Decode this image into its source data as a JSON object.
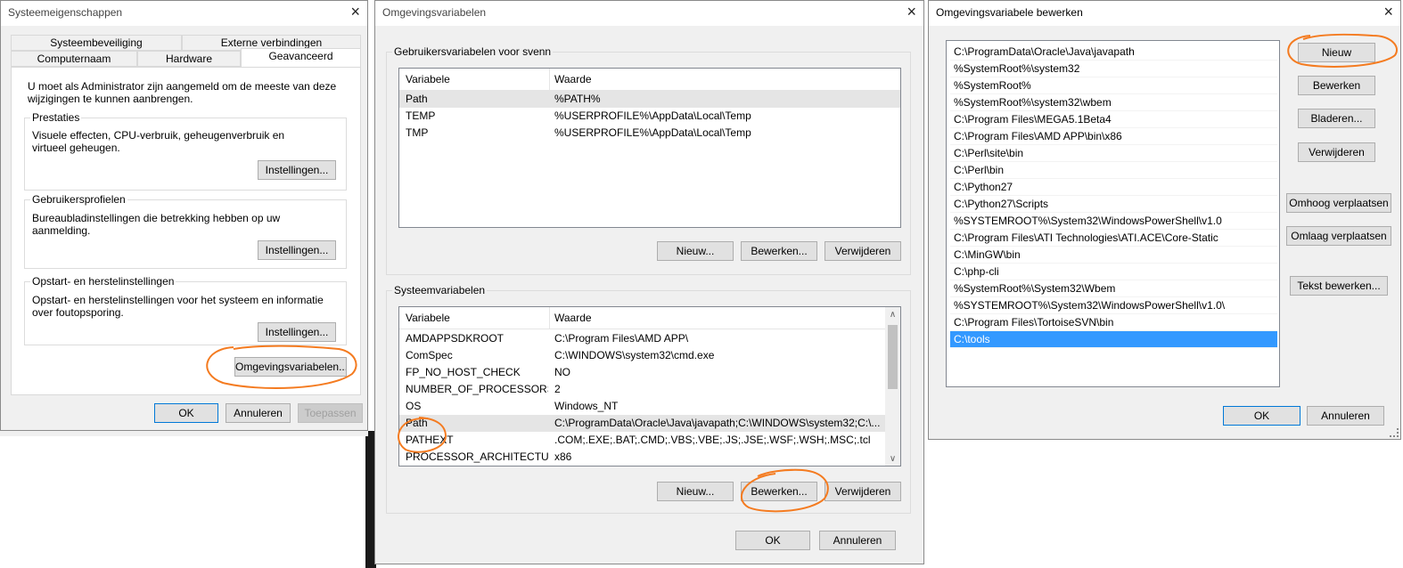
{
  "sysprops": {
    "title": "Systeemeigenschappen",
    "tabs_row1": [
      "Systeembeveiliging",
      "Externe verbindingen"
    ],
    "tabs_row2": [
      "Computernaam",
      "Hardware",
      "Geavanceerd"
    ],
    "admin_notice": "U moet als Administrator zijn aangemeld om de meeste van deze wijzigingen te kunnen aanbrengen.",
    "groups": [
      {
        "legend": "Prestaties",
        "text": "Visuele effecten, CPU-verbruik, geheugenverbruik en virtueel geheugen.",
        "button": "Instellingen..."
      },
      {
        "legend": "Gebruikersprofielen",
        "text": "Bureaubladinstellingen die betrekking hebben op uw aanmelding.",
        "button": "Instellingen..."
      },
      {
        "legend": "Opstart- en herstelinstellingen",
        "text": "Opstart- en herstelinstellingen voor het systeem en informatie over foutopsporing.",
        "button": "Instellingen..."
      }
    ],
    "envvars_button": "Omgevingsvariabelen...",
    "ok": "OK",
    "cancel": "Annuleren",
    "apply": "Toepassen"
  },
  "envvars": {
    "title": "Omgevingsvariabelen",
    "user_group": "Gebruikersvariabelen voor svenn",
    "col_var": "Variabele",
    "col_val": "Waarde",
    "user_rows": [
      {
        "name": "Path",
        "value": "%PATH%"
      },
      {
        "name": "TEMP",
        "value": "%USERPROFILE%\\AppData\\Local\\Temp"
      },
      {
        "name": "TMP",
        "value": "%USERPROFILE%\\AppData\\Local\\Temp"
      }
    ],
    "user_buttons": {
      "new": "Nieuw...",
      "edit": "Bewerken...",
      "delete": "Verwijderen"
    },
    "sys_group": "Systeemvariabelen",
    "sys_rows": [
      {
        "name": "AMDAPPSDKROOT",
        "value": "C:\\Program Files\\AMD APP\\"
      },
      {
        "name": "ComSpec",
        "value": "C:\\WINDOWS\\system32\\cmd.exe"
      },
      {
        "name": "FP_NO_HOST_CHECK",
        "value": "NO"
      },
      {
        "name": "NUMBER_OF_PROCESSORS",
        "value": "2"
      },
      {
        "name": "OS",
        "value": "Windows_NT"
      },
      {
        "name": "Path",
        "value": "C:\\ProgramData\\Oracle\\Java\\javapath;C:\\WINDOWS\\system32;C:\\..."
      },
      {
        "name": "PATHEXT",
        "value": ".COM;.EXE;.BAT;.CMD;.VBS;.VBE;.JS;.JSE;.WSF;.WSH;.MSC;.tcl"
      },
      {
        "name": "PROCESSOR_ARCHITECTURE",
        "value": "x86"
      }
    ],
    "sys_buttons": {
      "new": "Nieuw...",
      "edit": "Bewerken...",
      "delete": "Verwijderen"
    },
    "ok": "OK",
    "cancel": "Annuleren"
  },
  "editvar": {
    "title": "Omgevingsvariabele bewerken",
    "items": [
      "C:\\ProgramData\\Oracle\\Java\\javapath",
      "%SystemRoot%\\system32",
      "%SystemRoot%",
      "%SystemRoot%\\system32\\wbem",
      "C:\\Program Files\\MEGA5.1Beta4",
      "C:\\Program Files\\AMD APP\\bin\\x86",
      "C:\\Perl\\site\\bin",
      "C:\\Perl\\bin",
      "C:\\Python27",
      "C:\\Python27\\Scripts",
      "%SYSTEMROOT%\\System32\\WindowsPowerShell\\v1.0",
      "C:\\Program Files\\ATI Technologies\\ATI.ACE\\Core-Static",
      "C:\\MinGW\\bin",
      "C:\\php-cli",
      "%SystemRoot%\\System32\\Wbem",
      "%SYSTEMROOT%\\System32\\WindowsPowerShell\\v1.0\\",
      "C:\\Program Files\\TortoiseSVN\\bin",
      "C:\\tools"
    ],
    "buttons": {
      "new": "Nieuw",
      "edit": "Bewerken",
      "browse": "Bladeren...",
      "delete": "Verwijderen",
      "up": "Omhoog verplaatsen",
      "down": "Omlaag verplaatsen",
      "text_edit": "Tekst bewerken..."
    },
    "ok": "OK",
    "cancel": "Annuleren"
  },
  "icons": {
    "close": "×",
    "scroll_up": "∧",
    "scroll_down": "∨"
  },
  "colors": {
    "annotation": "#f47b20",
    "selection": "#3399ff",
    "accent_border": "#0078d7"
  }
}
